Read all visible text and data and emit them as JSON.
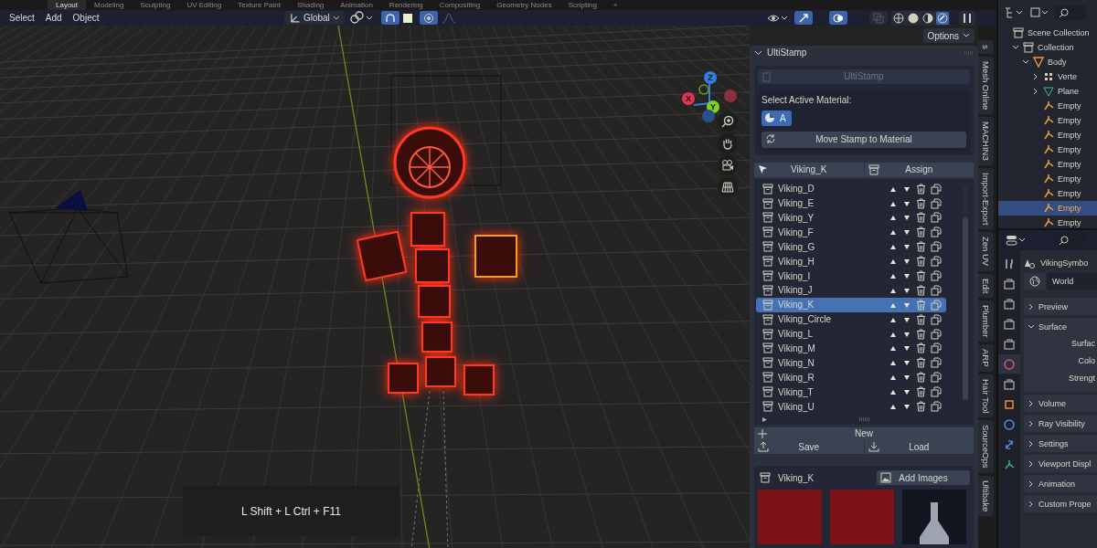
{
  "workspace_tabs": [
    {
      "label": "Layout",
      "selected": true
    },
    {
      "label": "Modeling",
      "selected": false
    },
    {
      "label": "Sculpting",
      "selected": false
    },
    {
      "label": "UV Editing",
      "selected": false
    },
    {
      "label": "Texture Paint",
      "selected": false
    },
    {
      "label": "Shading",
      "selected": false
    },
    {
      "label": "Animation",
      "selected": false
    },
    {
      "label": "Rendering",
      "selected": false
    },
    {
      "label": "Compositing",
      "selected": false
    },
    {
      "label": "Geometry Nodes",
      "selected": false
    },
    {
      "label": "Scripting",
      "selected": false
    },
    {
      "label": "+",
      "selected": false
    }
  ],
  "header_menu": [
    "Select",
    "Add",
    "Object"
  ],
  "transform_orientation": "Global",
  "shading_modes": [
    {
      "kind": "wireframe",
      "selected": false
    },
    {
      "kind": "solid",
      "selected": false
    },
    {
      "kind": "material",
      "selected": false
    },
    {
      "kind": "rendered",
      "selected": true
    }
  ],
  "options_button": "Options",
  "gizmo_axes": [
    {
      "label": "Z",
      "color": "#2e7fe0"
    },
    {
      "label": "X",
      "color": "#e0354f"
    },
    {
      "label": "Y",
      "color": "#80d020"
    }
  ],
  "shortcut_overlay": "L Shift + L Ctrl + F11",
  "sidebar_tabs": [
    "s",
    "Mesh Online",
    "MACHIN3",
    "Import-Export",
    "Zen UV",
    "Edit",
    "Plumber",
    "ARP",
    "Hair Tool",
    "SourceOps",
    "Ultibake"
  ],
  "ultistamp": {
    "panel_title": "UltiStamp",
    "header_button": "UltiStamp",
    "material_label": "Select Active Material:",
    "material_button": "A",
    "move_button": "Move Stamp to Material",
    "active_stamp": "Viking_K",
    "assign_button": "Assign",
    "stamps": [
      {
        "name": "Viking_D",
        "selected": false
      },
      {
        "name": "Viking_E",
        "selected": false
      },
      {
        "name": "Viking_Y",
        "selected": false
      },
      {
        "name": "Viking_F",
        "selected": false
      },
      {
        "name": "Viking_G",
        "selected": false
      },
      {
        "name": "Viking_H",
        "selected": false
      },
      {
        "name": "Viking_I",
        "selected": false
      },
      {
        "name": "Viking_J",
        "selected": false
      },
      {
        "name": "Viking_K",
        "selected": true
      },
      {
        "name": "Viking_Circle",
        "selected": false
      },
      {
        "name": "Viking_L",
        "selected": false
      },
      {
        "name": "Viking_M",
        "selected": false
      },
      {
        "name": "Viking_N",
        "selected": false
      },
      {
        "name": "Viking_R",
        "selected": false
      },
      {
        "name": "Viking_T",
        "selected": false
      },
      {
        "name": "Viking_U",
        "selected": false
      }
    ],
    "new_button": "New",
    "save_button": "Save",
    "load_button": "Load",
    "images_title": "Viking_K",
    "add_images_button": "Add Images"
  },
  "outliner": {
    "items": [
      {
        "label": "Scene Collection",
        "kind": "scene",
        "selected": false,
        "children": [
          {
            "label": "Collection",
            "kind": "collection",
            "selected": false,
            "expanded": true,
            "children": [
              {
                "label": "Body",
                "kind": "mesh",
                "selected": false,
                "expanded": true,
                "children": [
                  {
                    "label": "Verte",
                    "kind": "vertex",
                    "selected": false,
                    "expanded": false
                  },
                  {
                    "label": "Plane",
                    "kind": "plane",
                    "selected": false,
                    "expanded": false
                  },
                  {
                    "label": "Empty",
                    "kind": "empty",
                    "selected": false
                  },
                  {
                    "label": "Empty",
                    "kind": "empty",
                    "selected": false
                  },
                  {
                    "label": "Empty",
                    "kind": "empty",
                    "selected": false
                  },
                  {
                    "label": "Empty",
                    "kind": "empty",
                    "selected": false
                  },
                  {
                    "label": "Empty",
                    "kind": "empty",
                    "selected": false
                  },
                  {
                    "label": "Empty",
                    "kind": "empty",
                    "selected": false
                  },
                  {
                    "label": "Empty",
                    "kind": "empty",
                    "selected": false
                  },
                  {
                    "label": "Empty",
                    "kind": "empty",
                    "selected": true
                  },
                  {
                    "label": "Empty",
                    "kind": "empty",
                    "selected": false
                  }
                ]
              }
            ]
          }
        ]
      }
    ]
  },
  "properties": {
    "tabs": [
      {
        "kind": "tool",
        "selected": false
      },
      {
        "kind": "render",
        "selected": false
      },
      {
        "kind": "output",
        "selected": false
      },
      {
        "kind": "view-layer",
        "selected": false
      },
      {
        "kind": "scene",
        "selected": false
      },
      {
        "kind": "world",
        "selected": true
      },
      {
        "kind": "collection",
        "selected": false
      },
      {
        "kind": "object",
        "selected": false
      },
      {
        "kind": "physics",
        "selected": false
      },
      {
        "kind": "constraints",
        "selected": false
      },
      {
        "kind": "data",
        "selected": false
      }
    ],
    "object_name": "VikingSymbo",
    "world": "World",
    "panels": [
      {
        "label": "Preview",
        "expanded": false
      },
      {
        "label": "Surface",
        "expanded": true,
        "fields": [
          "Surfac",
          "Colo",
          "Strengt"
        ]
      },
      {
        "label": "Volume",
        "expanded": false
      },
      {
        "label": "Ray Visibility",
        "expanded": false
      },
      {
        "label": "Settings",
        "expanded": false
      },
      {
        "label": "Viewport Displ",
        "expanded": false
      },
      {
        "label": "Animation",
        "expanded": false
      },
      {
        "label": "Custom Prope",
        "expanded": false
      }
    ]
  }
}
